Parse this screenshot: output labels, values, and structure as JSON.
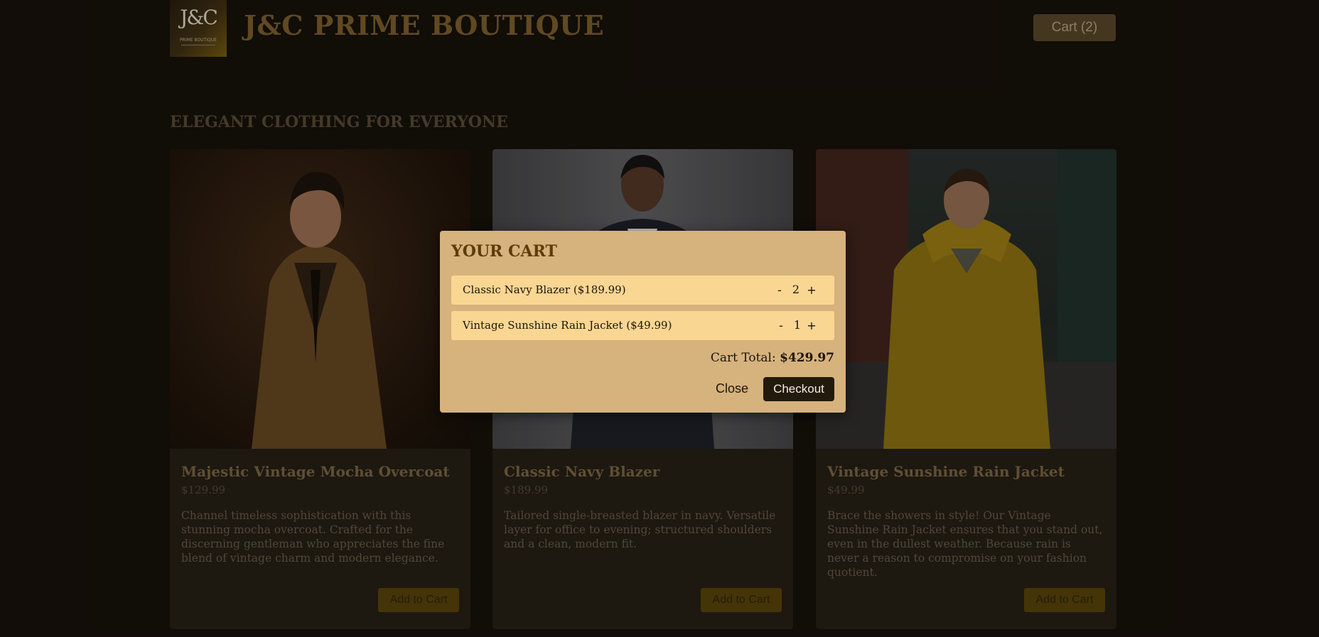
{
  "header": {
    "logo_mark": "J&C",
    "logo_sub": "PRIME BOUTIQUE",
    "title": "J&C PRIME BOUTIQUE",
    "cart_button": "Cart (2)"
  },
  "section_title": "ELEGANT CLOTHING FOR EVERYONE",
  "products": [
    {
      "name": "Majestic Vintage Mocha Overcoat",
      "price": "$129.99",
      "description": "Channel timeless sophistication with this stunning mocha overcoat. Crafted for the discerning gentleman who appreciates the fine blend of vintage charm and modern elegance.",
      "button": "Add to Cart"
    },
    {
      "name": "Classic Navy Blazer",
      "price": "$189.99",
      "description": "Tailored single-breasted blazer in navy. Versatile layer for office to evening; structured shoulders and a clean, modern fit.",
      "button": "Add to Cart"
    },
    {
      "name": "Vintage Sunshine Rain Jacket",
      "price": "$49.99",
      "description": "Brace the showers in style! Our Vintage Sunshine Rain Jacket ensures that you stand out, even in the dullest weather. Because rain is never a reason to compromise on your fashion quotient.",
      "button": "Add to Cart"
    }
  ],
  "cart_modal": {
    "title": "YOUR CART",
    "items": [
      {
        "label": "Classic Navy Blazer ($189.99)",
        "minus": "-",
        "qty": "2",
        "plus": "+"
      },
      {
        "label": "Vintage Sunshine Rain Jacket ($49.99)",
        "minus": "-",
        "qty": "1",
        "plus": "+"
      }
    ],
    "total_label": "Cart Total:",
    "total_value": "$429.97",
    "close_button": "Close",
    "checkout_button": "Checkout"
  },
  "colors": {
    "page_bg": "#140f09",
    "title_gold": "#6e5427",
    "modal_bg": "#d6b27c",
    "cart_row_bg": "#fad693",
    "checkout_bg": "#231a0e"
  }
}
